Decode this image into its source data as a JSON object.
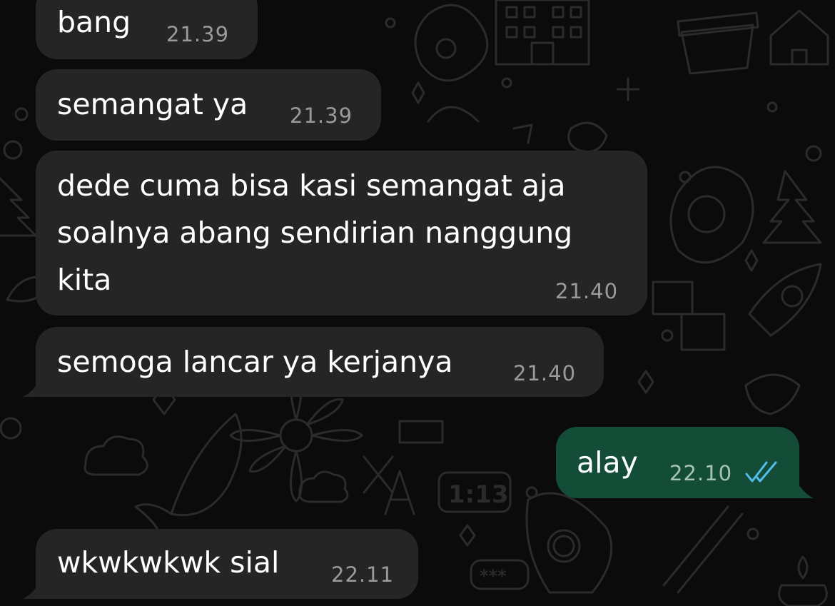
{
  "theme": {
    "background": "#0b0b0b",
    "incoming_bubble": "#252525",
    "outgoing_bubble": "#134d37",
    "read_tick_color": "#53bdeb"
  },
  "messages": [
    {
      "direction": "incoming",
      "text": "bang",
      "time": "21.39"
    },
    {
      "direction": "incoming",
      "text": "semangat ya",
      "time": "21.39"
    },
    {
      "direction": "incoming",
      "lines": [
        "dede cuma bisa kasi semangat aja",
        "soalnya abang sendirian nanggung",
        "kita"
      ],
      "time": "21.40"
    },
    {
      "direction": "incoming",
      "text": "semoga lancar ya kerjanya",
      "time": "21.40"
    },
    {
      "direction": "outgoing",
      "text": "alay",
      "time": "22.10",
      "status": "read"
    },
    {
      "direction": "incoming",
      "text": "wkwkwkwk sial",
      "time": "22.11"
    }
  ],
  "wallpaper": {
    "clock_text": "1:13",
    "password_text": "***",
    "icons": [
      "house-icon",
      "egg-icon",
      "flowerpot-icon",
      "building-icon",
      "sparkle-icon",
      "plus-icon",
      "rocket-icon",
      "bird-icon",
      "tree-icon",
      "flower-icon",
      "whale-icon",
      "cloud-icon",
      "bowl-icon",
      "chopsticks-icon",
      "avocado-icon",
      "sun-icon",
      "candle-icon"
    ]
  }
}
